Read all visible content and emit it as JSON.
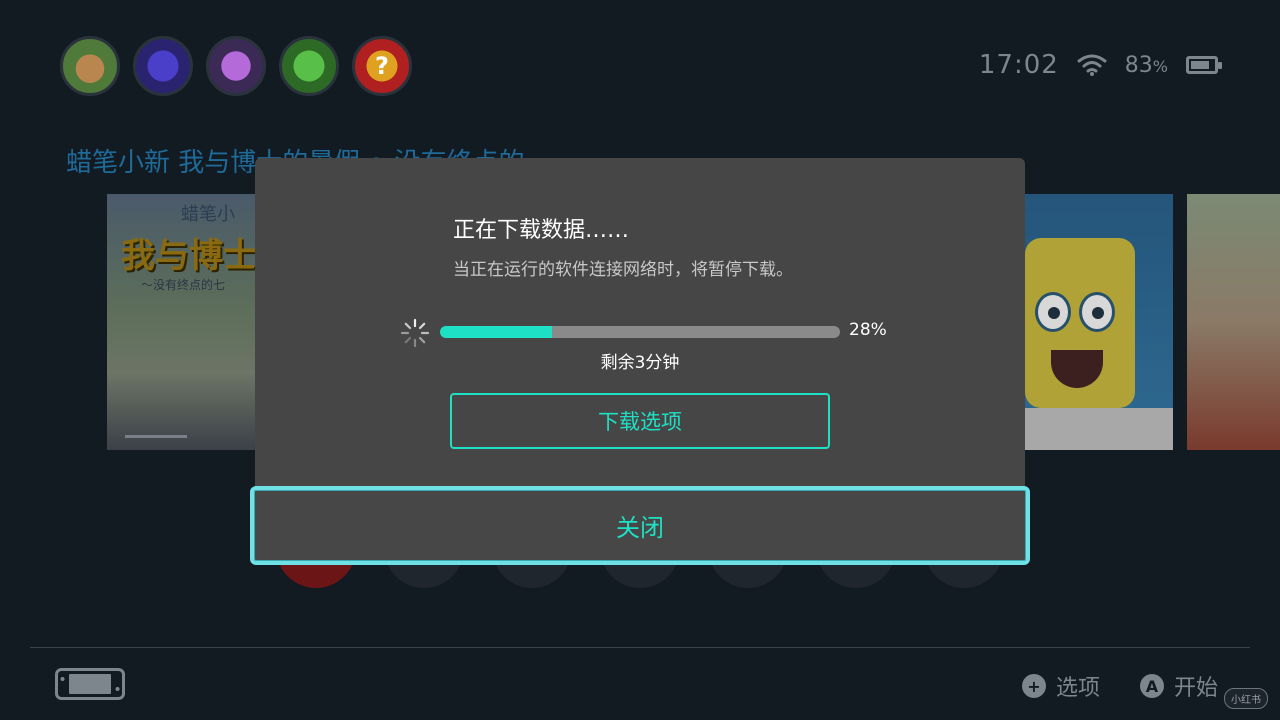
{
  "top_bar": {
    "avatars": [
      {
        "name": "user-avatar-1",
        "glyph": ""
      },
      {
        "name": "user-avatar-2",
        "glyph": ""
      },
      {
        "name": "user-avatar-3",
        "glyph": ""
      },
      {
        "name": "user-avatar-4",
        "glyph": ""
      },
      {
        "name": "user-avatar-5",
        "glyph": "?"
      }
    ],
    "time": "17:02",
    "battery_percent": "83",
    "battery_unit": "%",
    "battery_level": 0.83,
    "icons": [
      "wifi-icon",
      "battery-icon"
    ]
  },
  "home": {
    "game_title": "蜡笔小新 我与博士的暑假 ～没有终点的",
    "tiles": [
      {
        "title_small": "蜡笔小",
        "title_big": "我与博士的",
        "subtitle": "～没有终点的七"
      },
      {},
      {}
    ]
  },
  "dialog": {
    "title": "正在下载数据……",
    "subtitle": "当正在运行的软件连接网络时，将暂停下载。",
    "progress_fraction": 0.28,
    "progress_text": "28%",
    "remaining_text": "剩余3分钟",
    "options_label": "下载选项",
    "close_label": "关闭"
  },
  "footer": {
    "options_glyph": "+",
    "options_label": "选项",
    "start_glyph": "A",
    "start_label": "开始",
    "watermark": "小红书"
  },
  "colors": {
    "accent": "#1ee0c4",
    "focus_border": "#6fe0e6",
    "dialog_bg": "#464646",
    "page_bg": "#121a22"
  }
}
